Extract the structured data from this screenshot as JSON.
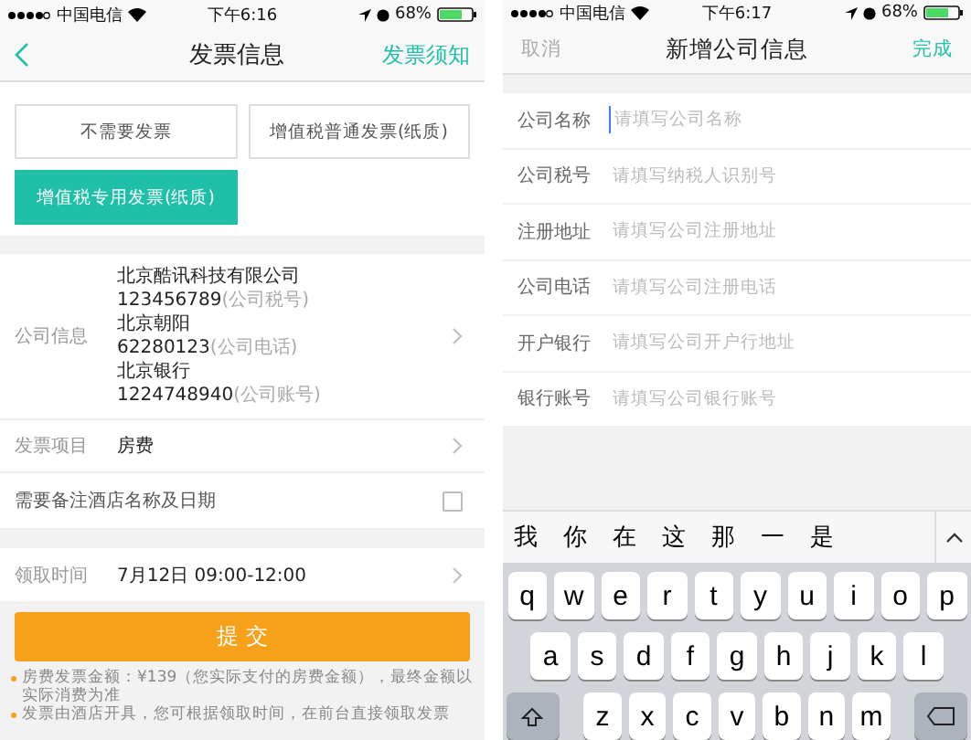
{
  "invoice_screen": {
    "status_bar": {
      "carrier": "中国电信",
      "time": "下午6:16",
      "battery": "68%"
    },
    "nav": {
      "title": "发票信息",
      "action": "发票须知"
    },
    "invoice_types": [
      {
        "label": "不需要发票",
        "selected": false
      },
      {
        "label": "增值税普通发票(纸质)",
        "selected": false
      },
      {
        "label": "增值税专用发票(纸质)",
        "selected": true
      }
    ],
    "company_info": {
      "label": "公司信息",
      "lines": [
        {
          "value": "北京酷讯科技有限公司"
        },
        {
          "value": "123456789",
          "note": "(公司税号)"
        },
        {
          "value": "北京朝阳"
        },
        {
          "value": "62280123",
          "note": "(公司电话)"
        },
        {
          "value": "北京银行"
        },
        {
          "value": "1224748940",
          "note": "(公司账号)"
        }
      ]
    },
    "item_row": {
      "label": "发票项目",
      "value": "房费"
    },
    "remark": {
      "label": "需要备注酒店名称及日期",
      "checked": false
    },
    "pickup": {
      "label": "领取时间",
      "value": "7月12日 09:00-12:00"
    },
    "submit": "提 交",
    "notes": [
      "房费发票金额：¥139（您实际支付的房费金额），最终金额以实际消费为准",
      "发票由酒店开具，您可根据领取时间，在前台直接领取发票"
    ]
  },
  "new_company_screen": {
    "status_bar": {
      "carrier": "中国电信",
      "time": "下午6:17",
      "battery": "68%"
    },
    "nav": {
      "cancel": "取消",
      "title": "新增公司信息",
      "done": "完成"
    },
    "fields": [
      {
        "label": "公司名称",
        "placeholder": "请填写公司名称",
        "focused": true
      },
      {
        "label": "公司税号",
        "placeholder": "请填写纳税人识别号",
        "focused": false
      },
      {
        "label": "注册地址",
        "placeholder": "请填写公司注册地址",
        "focused": false
      },
      {
        "label": "公司电话",
        "placeholder": "请填写公司注册电话",
        "focused": false
      },
      {
        "label": "开户银行",
        "placeholder": "请填写公司开户行地址",
        "focused": false
      },
      {
        "label": "银行账号",
        "placeholder": "请填写公司银行账号",
        "focused": false
      }
    ],
    "candidates": [
      "我",
      "你",
      "在",
      "这",
      "那",
      "一",
      "是"
    ],
    "keyboard_rows": [
      [
        "q",
        "w",
        "e",
        "r",
        "t",
        "y",
        "u",
        "i",
        "o",
        "p"
      ],
      [
        "a",
        "s",
        "d",
        "f",
        "g",
        "h",
        "j",
        "k",
        "l"
      ],
      [
        "z",
        "x",
        "c",
        "v",
        "b",
        "n",
        "m"
      ]
    ]
  }
}
